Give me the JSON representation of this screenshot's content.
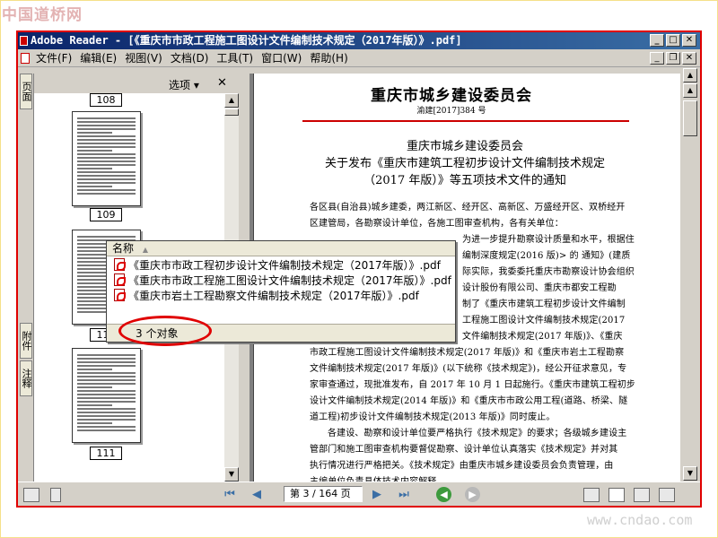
{
  "watermark_top": "中国道桥网",
  "watermark_bottom": "www.cndao.com",
  "window": {
    "title": "Adobe Reader - [《重庆市市政工程施工图设计文件编制技术规定（2017年版）》.pdf]"
  },
  "menu": {
    "items": [
      "文件(F)",
      "编辑(E)",
      "视图(V)",
      "文档(D)",
      "工具(T)",
      "窗口(W)",
      "帮助(H)"
    ]
  },
  "side_tabs": [
    "页面",
    "附件",
    "注释"
  ],
  "thumb_panel": {
    "options_label": "选项 ▾",
    "pages": [
      "108",
      "109",
      "110",
      "111"
    ]
  },
  "document": {
    "org_title": "重庆市城乡建设委员会",
    "doc_number": "渝建[2017]384 号",
    "notice_lines": [
      "重庆市城乡建设委员会",
      "关于发布《重庆市建筑工程初步设计文件编制技术规定",
      "（2017 年版）》等五项技术文件的通知"
    ],
    "body_lines": [
      "各区县(自治县)城乡建委，两江新区、经开区、高新区、万盛经开区、双桥经开",
      "区建管局，各勘察设计单位，各施工图审查机构，各有关单位：",
      "为进一步提升勘察设计质量和水平，根据住",
      "编制深度规定(2016 版)> 的 通知》(建质",
      "际实际，我委委托重庆市勘察设计协会组织",
      "设计股份有限公司、重庆市都安工程勘",
      "制了《重庆市建筑工程初步设计文件编制",
      "工程施工图设计文件编制技术规定(2017",
      "文件编制技术规定(2017 年版)》、《重庆",
      "市政工程施工图设计文件编制技术规定(2017 年版)》和《重庆市岩土工程勘察",
      "文件编制技术规定(2017 年版)》(以下统称《技术规定》)，经公开征求意见，专",
      "家审查通过，现批准发布，自 2017 年 10 月 1 日起施行。《重庆市建筑工程初步",
      "设计文件编制技术规定(2014 年版)》和《重庆市市政公用工程(道路、桥梁、隧",
      "道工程)初步设计文件编制技术规定(2013 年版)》同时废止。",
      "各建设、勘察和设计单位要严格执行《技术规定》的要求；各级城乡建设主",
      "管部门和施工图审查机构要督促勘察、设计单位认真落实《技术规定》并对其",
      "执行情况进行严格把关。《技术规定》由重庆市城乡建设委员会负责管理，由",
      "主编单位负责具体技术内容解释。"
    ]
  },
  "popup": {
    "column_header": "名称",
    "files": [
      "《重庆市市政工程初步设计文件编制技术规定（2017年版）》.pdf",
      "《重庆市市政工程施工图设计文件编制技术规定（2017年版）》.pdf",
      "《重庆市岩土工程勘察文件编制技术规定（2017年版）》.pdf"
    ],
    "status": "3 个对象"
  },
  "statusbar": {
    "page_field": "第 3 / 164 页"
  },
  "colors": {
    "title_bar": "#0a246a",
    "highlight_red": "#e00000",
    "chrome": "#d4d0c8"
  }
}
